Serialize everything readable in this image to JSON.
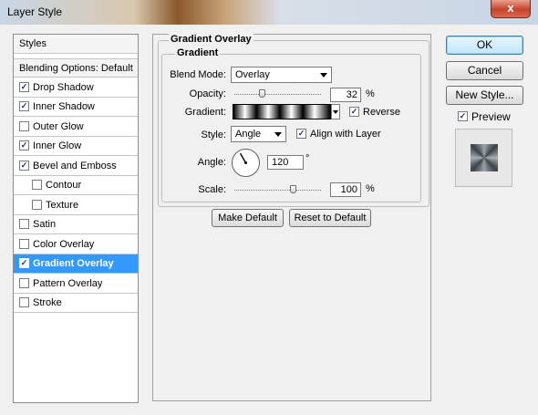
{
  "window": {
    "title": "Layer Style",
    "close_glyph": "x"
  },
  "styles_list": {
    "header": "Styles",
    "blending": "Blending Options: Default",
    "items": [
      {
        "label": "Drop Shadow",
        "checked": true,
        "check": "✓"
      },
      {
        "label": "Inner Shadow",
        "checked": true,
        "check": "✓"
      },
      {
        "label": "Outer Glow",
        "checked": false,
        "check": ""
      },
      {
        "label": "Inner Glow",
        "checked": true,
        "check": "✓"
      },
      {
        "label": "Bevel and Emboss",
        "checked": true,
        "check": "✓"
      },
      {
        "label": "Contour",
        "checked": false,
        "check": ""
      },
      {
        "label": "Texture",
        "checked": false,
        "check": ""
      },
      {
        "label": "Satin",
        "checked": false,
        "check": ""
      },
      {
        "label": "Color Overlay",
        "checked": false,
        "check": ""
      },
      {
        "label": "Gradient Overlay",
        "checked": true,
        "check": "✓",
        "selected": true
      },
      {
        "label": "Pattern Overlay",
        "checked": false,
        "check": ""
      },
      {
        "label": "Stroke",
        "checked": false,
        "check": ""
      }
    ]
  },
  "panel": {
    "title": "Gradient Overlay",
    "group_title": "Gradient",
    "blend_mode": {
      "label": "Blend Mode:",
      "value": "Overlay"
    },
    "opacity": {
      "label": "Opacity:",
      "value": "32",
      "unit": "%",
      "level": 0.32
    },
    "gradient": {
      "label": "Gradient:",
      "reverse_label": "Reverse",
      "reverse_checked": true,
      "check": "✓"
    },
    "style": {
      "label": "Style:",
      "value": "Angle",
      "align_label": "Align with Layer",
      "align_checked": true,
      "check": "✓"
    },
    "angle": {
      "label": "Angle:",
      "value": "120",
      "unit": "°"
    },
    "scale": {
      "label": "Scale:",
      "value": "100",
      "unit": "%",
      "level": 0.67
    },
    "make_default": "Make Default",
    "reset_default": "Reset to Default"
  },
  "buttons": {
    "ok": "OK",
    "cancel": "Cancel",
    "new_style": "New Style...",
    "preview_label": "Preview",
    "preview_checked": true,
    "preview_check": "✓"
  }
}
